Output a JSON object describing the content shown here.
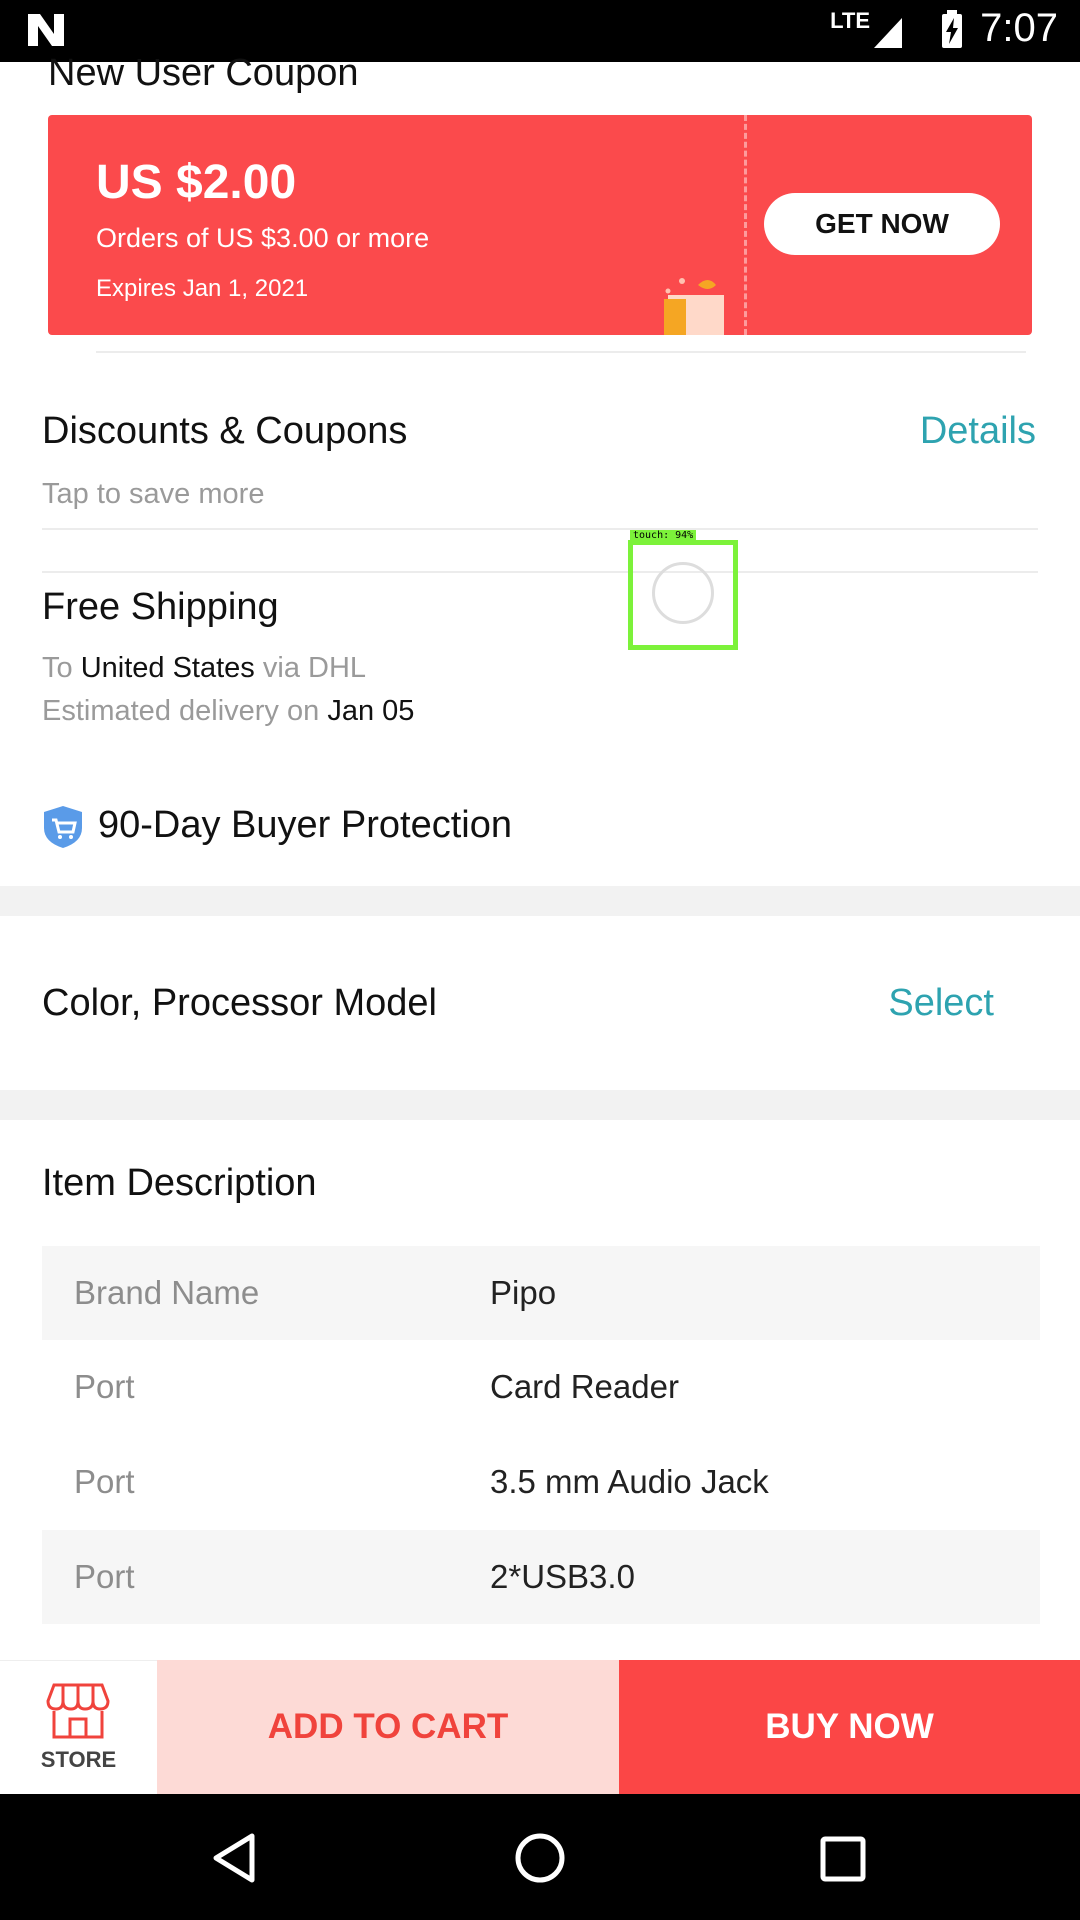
{
  "status_bar": {
    "network": "LTE",
    "time": "7:07"
  },
  "coupon": {
    "section_title": "New User Coupon",
    "amount": "US $2.00",
    "condition": "Orders of US $3.00 or more",
    "expires": "Expires Jan 1, 2021",
    "cta": "GET NOW"
  },
  "discounts": {
    "title": "Discounts & Coupons",
    "subtitle": "Tap to save more",
    "link": "Details"
  },
  "shipping": {
    "title": "Free Shipping",
    "to_prefix": "To",
    "destination": "United States",
    "via": "via DHL",
    "eta_prefix": "Estimated delivery on",
    "eta_date": "Jan 05"
  },
  "protection": {
    "label": "90-Day Buyer Protection"
  },
  "variant": {
    "label": "Color, Processor Model",
    "action": "Select"
  },
  "description": {
    "title": "Item Description",
    "rows": [
      {
        "key": "Brand Name",
        "value": "Pipo"
      },
      {
        "key": "Port",
        "value": "Card Reader"
      },
      {
        "key": "Port",
        "value": "3.5 mm Audio Jack"
      },
      {
        "key": "Port",
        "value": "2*USB3.0"
      }
    ]
  },
  "touch_overlay": {
    "label": "touch: 94%"
  },
  "action_bar": {
    "store_label": "STORE",
    "add_to_cart": "ADD TO CART",
    "buy_now": "BUY NOW"
  },
  "colors": {
    "accent_red": "#fb4646",
    "teal_link": "#2ea3b0",
    "cart_bg": "#fddad6"
  }
}
